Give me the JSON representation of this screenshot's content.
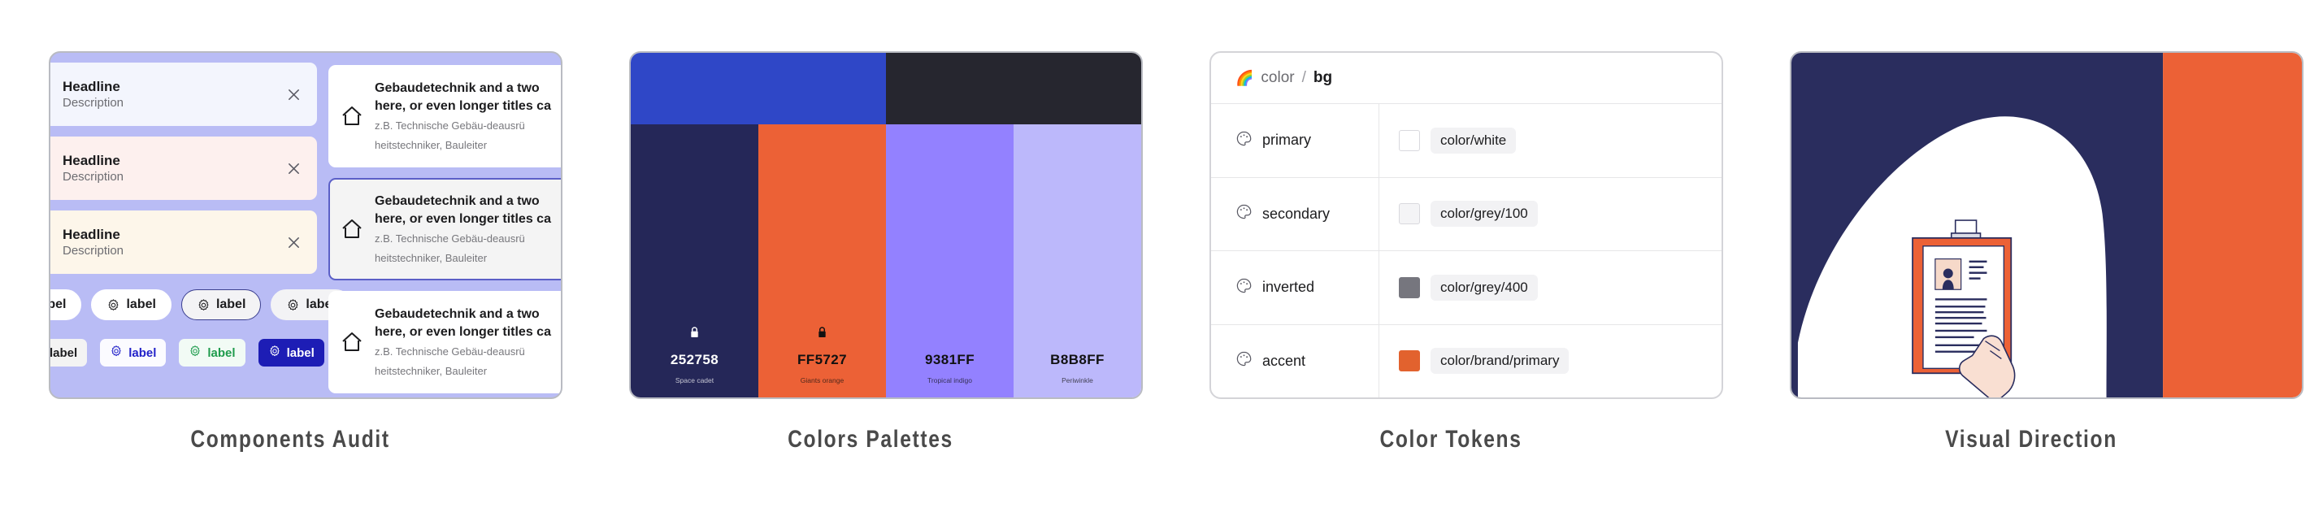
{
  "panels": [
    {
      "caption": "Components Audit"
    },
    {
      "caption": "Colors Palettes"
    },
    {
      "caption": "Color Tokens"
    },
    {
      "caption": "Visual Direction"
    }
  ],
  "components_audit": {
    "alerts": [
      {
        "title": "Headline",
        "description": "Description",
        "variant": "info",
        "icon": "note-info-icon",
        "icon_color": "#2c3fd4",
        "bg": "#f3f5fd",
        "close": "close-icon"
      },
      {
        "title": "Headline",
        "description": "Description",
        "variant": "error",
        "icon": "note-error-icon",
        "icon_color": "#c32b1e",
        "bg": "#fdf0ee",
        "close": "close-icon"
      },
      {
        "title": "Headline",
        "description": "Description",
        "variant": "warning",
        "icon": "note-warning-icon",
        "icon_color": "#d79a22",
        "bg": "#fdf6ea",
        "close": "close-icon"
      }
    ],
    "chips_round": [
      {
        "label": "label",
        "style": "ghost",
        "has_icon": false
      },
      {
        "label": "label",
        "style": "ghost",
        "has_icon": true
      },
      {
        "label": "label",
        "style": "outline",
        "has_icon": true
      },
      {
        "label": "label",
        "style": "soft",
        "has_icon": true
      }
    ],
    "chips_square": [
      {
        "label": "label",
        "style": "grey"
      },
      {
        "label": "label",
        "style": "blue"
      },
      {
        "label": "label",
        "style": "green"
      },
      {
        "label": "label",
        "style": "solid"
      }
    ],
    "info_cards": [
      {
        "title": "Gebaudetechnik and a two",
        "title_line2": "here, or even longer titles ca",
        "sub": "z.B. Technische Gebäu-deausrü",
        "sub_line2": "heitstechniker, Bauleiter",
        "selected": false,
        "icon": "home-icon"
      },
      {
        "title": "Gebaudetechnik and a two",
        "title_line2": "here, or even longer titles ca",
        "sub": "z.B. Technische Gebäu-deausrü",
        "sub_line2": "heitstechniker, Bauleiter",
        "selected": true,
        "icon": "home-icon"
      },
      {
        "title": "Gebaudetechnik and a two",
        "title_line2": "here, or even longer titles ca",
        "sub": "z.B. Technische Gebäu-deausrü",
        "sub_line2": "heitstechniker, Bauleiter",
        "selected": false,
        "icon": "home-icon"
      }
    ],
    "panel_bg": "#b9bcf5"
  },
  "colors_palettes": {
    "top": [
      {
        "hex": "#2F47C7",
        "name": "",
        "code": ""
      },
      {
        "hex": "#26262F",
        "name": "",
        "code": ""
      }
    ],
    "swatches": [
      {
        "code": "252758",
        "name": "Space cadet",
        "hex": "#252758",
        "text": "#ffffff",
        "locked": true,
        "lock_color": "#ffffff"
      },
      {
        "code": "FF5727",
        "name": "Giants orange",
        "hex": "#EC6136",
        "text": "#111111",
        "locked": true,
        "lock_color": "#111111"
      },
      {
        "code": "9381FF",
        "name": "Tropical indigo",
        "hex": "#9381FF",
        "text": "#111111",
        "locked": false,
        "lock_color": "#111111"
      },
      {
        "code": "B8B8FF",
        "name": "Periwinkle",
        "hex": "#BCB8FB",
        "text": "#111111",
        "locked": false,
        "lock_color": "#111111"
      }
    ]
  },
  "color_tokens": {
    "header": {
      "icon": "rainbow-icon",
      "group": "color",
      "separator": "/",
      "leaf": "bg"
    },
    "rows": [
      {
        "icon": "palette-icon",
        "name": "primary",
        "swatch": "#ffffff",
        "value": "color/white"
      },
      {
        "icon": "palette-icon",
        "name": "secondary",
        "swatch": "#f4f4f6",
        "value": "color/grey/100"
      },
      {
        "icon": "palette-icon",
        "name": "inverted",
        "swatch": "#76767e",
        "value": "color/grey/400"
      },
      {
        "icon": "palette-icon",
        "name": "accent",
        "swatch": "#E2622E",
        "value": "color/brand/primary"
      }
    ]
  },
  "visual_direction": {
    "navy": "#2A2D5E",
    "orange": "#EC6136",
    "white": "#ffffff",
    "illustration": "hand-holding-clipboard-resume-illustration"
  }
}
